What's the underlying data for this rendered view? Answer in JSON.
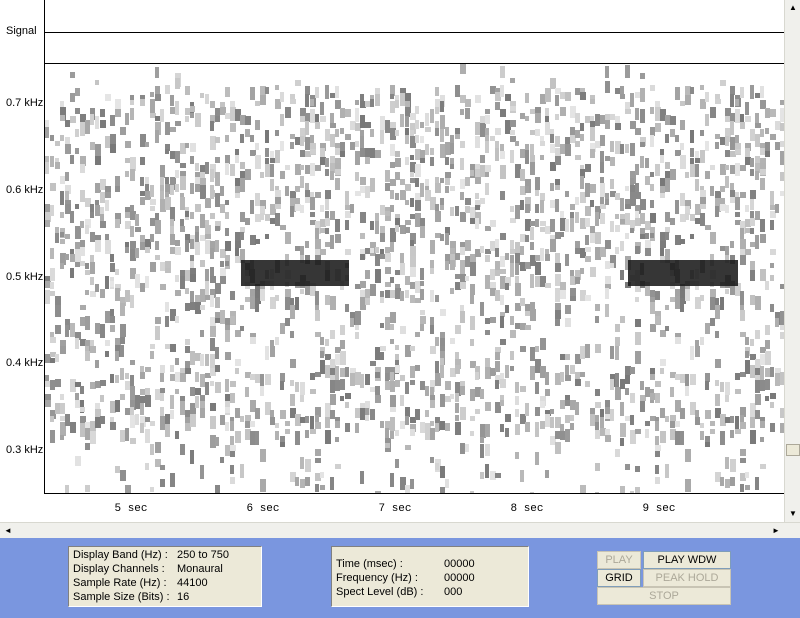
{
  "signal_label": "Signal",
  "frequency_labels": [
    "0.7 kHz",
    "0.6 kHz",
    "0.5 kHz",
    "0.4 kHz",
    "0.3 kHz"
  ],
  "time_labels": [
    "5 sec",
    "6 sec",
    "7 sec",
    "8 sec",
    "9 sec"
  ],
  "scrollbars": {
    "up": "▲",
    "down": "▼",
    "left": "◄",
    "right": "►"
  },
  "settings": {
    "display_band_label": "Display Band (Hz) :",
    "display_band_value": "250 to 750",
    "display_channels_label": "Display Channels :",
    "display_channels_value": "Monaural",
    "sample_rate_label": "Sample Rate (Hz) :",
    "sample_rate_value": "44100",
    "sample_size_label": "Sample Size (Bits) :",
    "sample_size_value": "16"
  },
  "cursor": {
    "time_label": "Time (msec) :",
    "time_value": "00000",
    "frequency_label": "Frequency (Hz) :",
    "frequency_value": "00000",
    "spect_level_label": "Spect Level (dB) :",
    "spect_level_value": "000"
  },
  "buttons": {
    "play": "PLAY",
    "play_wdw": "PLAY WDW",
    "grid": "GRID",
    "peak_hold": "PEAK HOLD",
    "stop": "STOP"
  },
  "colors": {
    "panel_background": "#7a96df",
    "tone_band": "#1a1a1a",
    "noise": "#909090"
  }
}
